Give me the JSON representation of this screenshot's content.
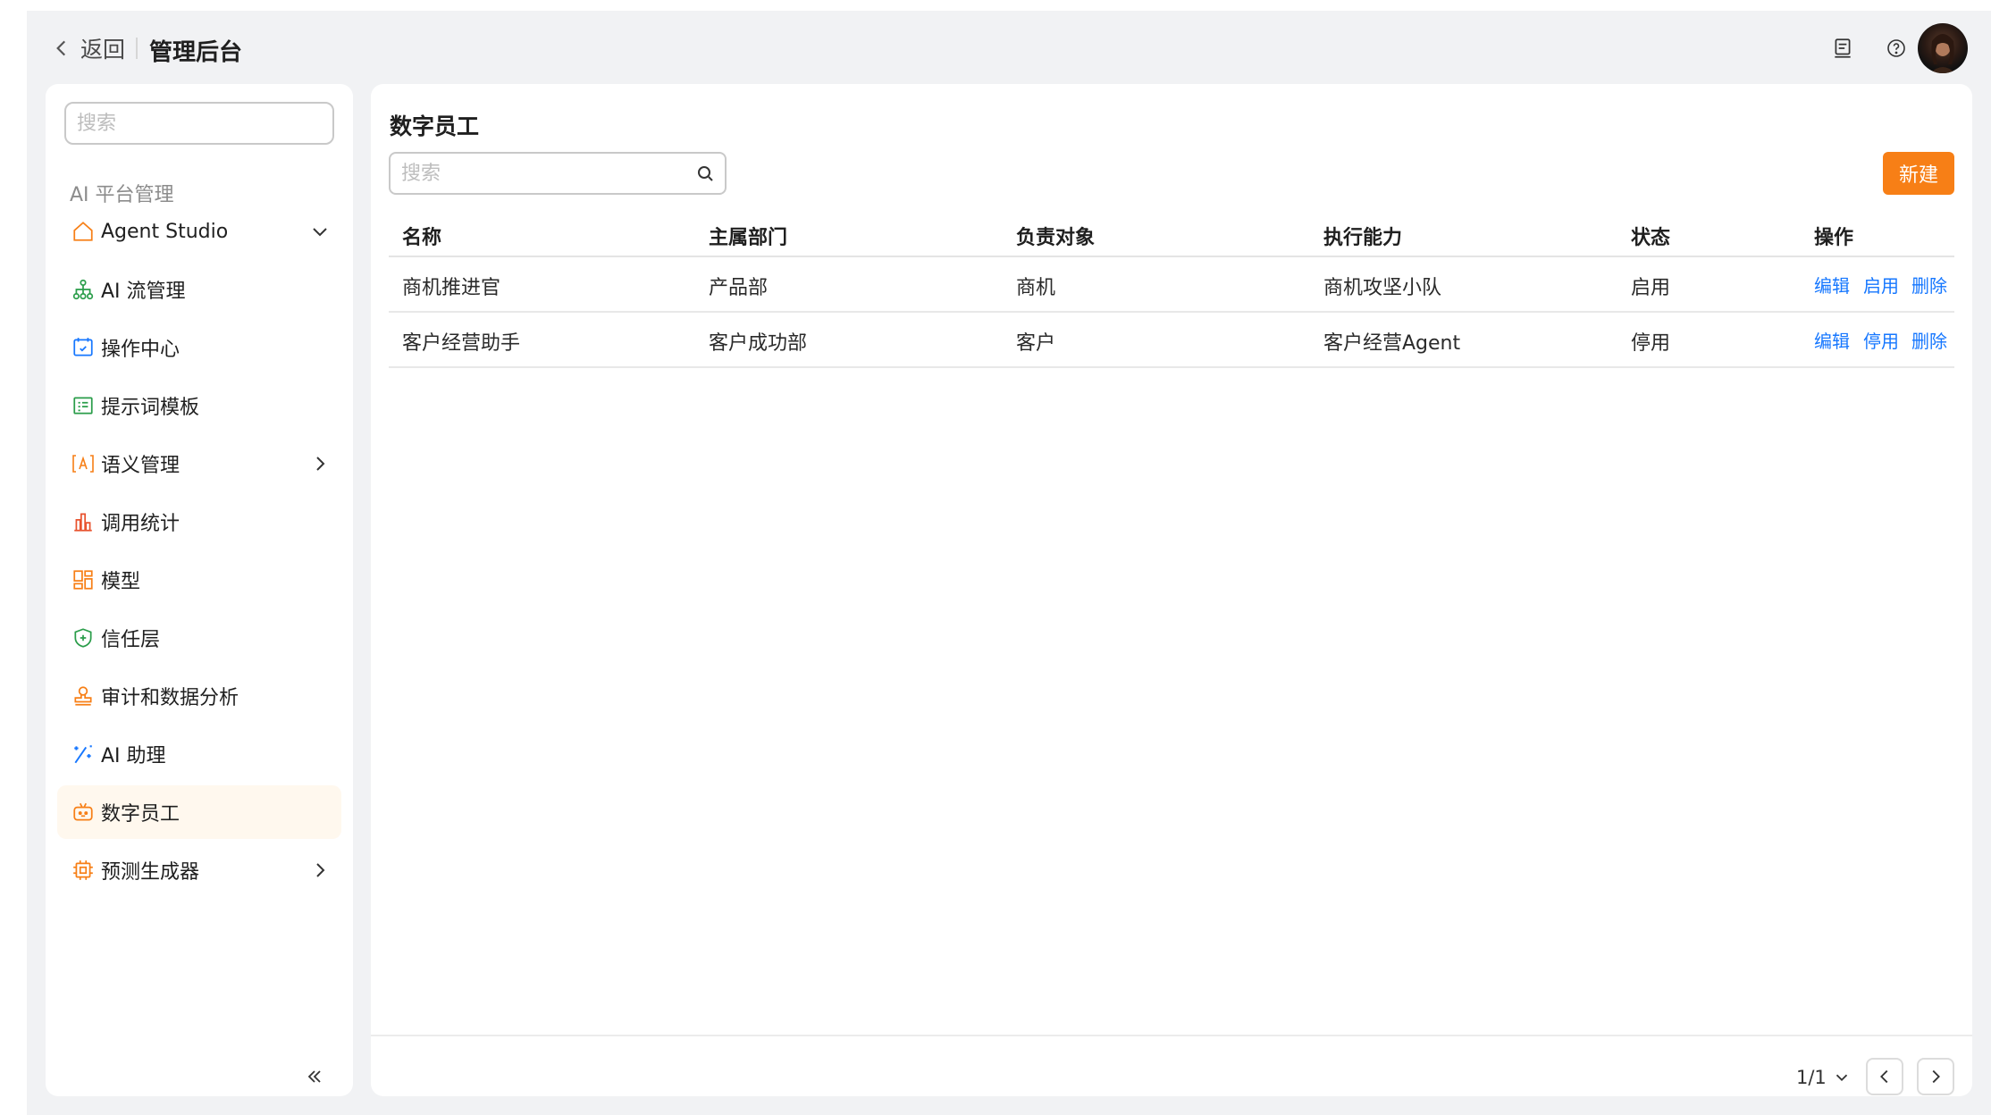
{
  "header": {
    "back_label": "返回",
    "app_title": "管理后台"
  },
  "sidebar": {
    "search_placeholder": "搜索",
    "section_title": "AI 平台管理",
    "items": [
      {
        "label": "Agent Studio",
        "icon": "home-icon",
        "expand": "chevron-down"
      },
      {
        "label": "AI 流管理",
        "icon": "flow-tree-icon"
      },
      {
        "label": "操作中心",
        "icon": "operation-calendar-icon"
      },
      {
        "label": "提示词模板",
        "icon": "template-list-icon"
      },
      {
        "label": "语义管理",
        "icon": "semantic-bracket-icon",
        "expand": "chevron-right"
      },
      {
        "label": "调用统计",
        "icon": "bar-stats-icon"
      },
      {
        "label": "模型",
        "icon": "model-grid-icon"
      },
      {
        "label": "信任层",
        "icon": "shield-icon"
      },
      {
        "label": "审计和数据分析",
        "icon": "audit-stamp-icon"
      },
      {
        "label": "AI 助理",
        "icon": "magic-wand-icon"
      },
      {
        "label": "数字员工",
        "icon": "robot-icon",
        "active": true
      },
      {
        "label": "预测生成器",
        "icon": "chip-icon",
        "expand": "chevron-right"
      }
    ]
  },
  "main": {
    "title": "数字员工",
    "search_placeholder": "搜索",
    "new_button": "新建",
    "columns": [
      "名称",
      "主属部门",
      "负责对象",
      "执行能力",
      "状态",
      "操作"
    ],
    "rows": [
      {
        "name": "商机推进官",
        "dept": "产品部",
        "target": "商机",
        "capability": "商机攻坚小队",
        "status": "启用",
        "actions": [
          "编辑",
          "启用",
          "删除"
        ]
      },
      {
        "name": "客户经营助手",
        "dept": "客户成功部",
        "target": "客户",
        "capability": "客户经营Agent",
        "status": "停用",
        "actions": [
          "编辑",
          "停用",
          "删除"
        ]
      }
    ],
    "pager": {
      "page_text": "1/1"
    }
  },
  "colors": {
    "accent": "#f77f16",
    "link": "#1677ff",
    "active_bg": "#fff8ee",
    "frame_bg": "#f1f2f4"
  }
}
